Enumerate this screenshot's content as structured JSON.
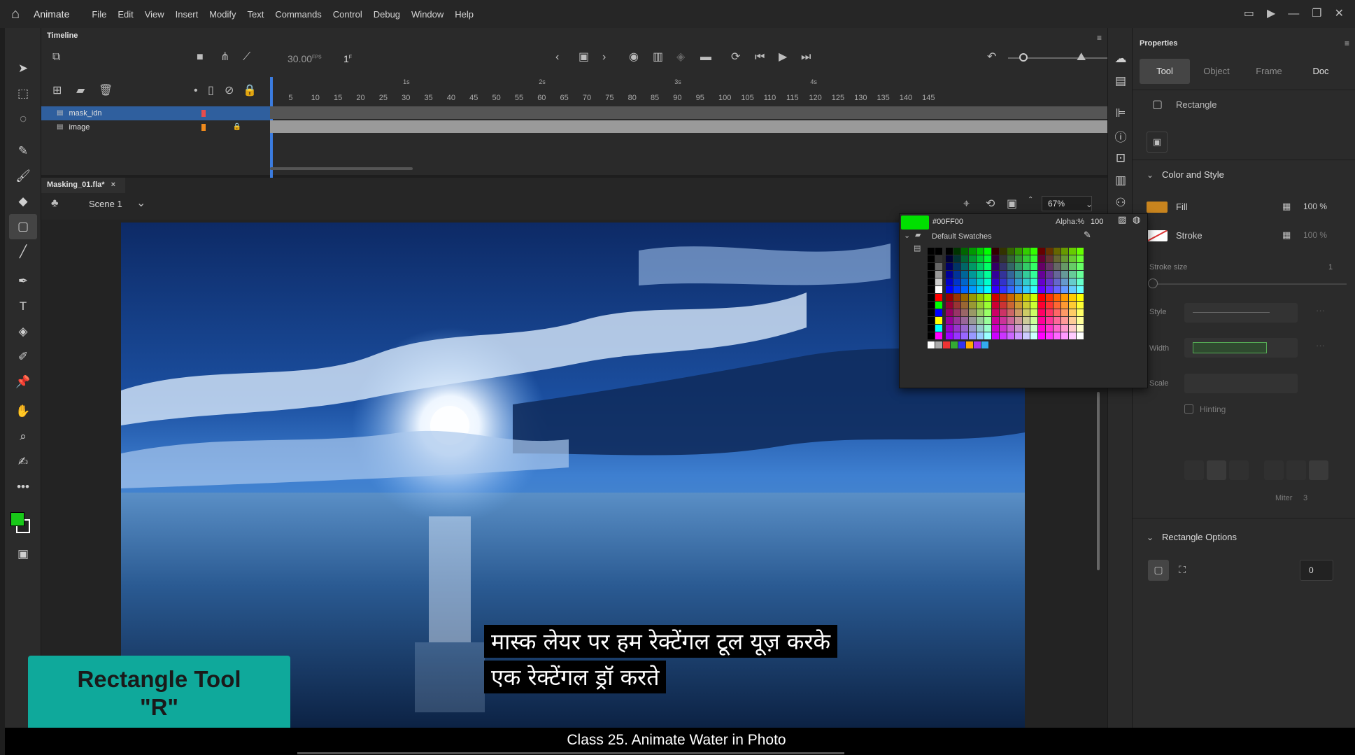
{
  "menubar": {
    "app_name": "Animate",
    "items": [
      "File",
      "Edit",
      "View",
      "Insert",
      "Modify",
      "Text",
      "Commands",
      "Control",
      "Debug",
      "Window",
      "Help"
    ]
  },
  "timeline": {
    "title": "Timeline",
    "fps": "30.00",
    "fps_unit": "FPS",
    "frame": "1",
    "frame_unit": "F",
    "seconds": [
      "1s",
      "2s",
      "3s",
      "4s"
    ],
    "frame_ticks": [
      "5",
      "10",
      "15",
      "20",
      "25",
      "30",
      "35",
      "40",
      "45",
      "50",
      "55",
      "60",
      "65",
      "70",
      "75",
      "80",
      "85",
      "90",
      "95",
      "100",
      "105",
      "110",
      "115",
      "120",
      "125",
      "130",
      "135",
      "140",
      "145"
    ],
    "layers": [
      {
        "name": "mask_idn",
        "color": "#e84c4c",
        "selected": true,
        "locked": false
      },
      {
        "name": "image",
        "color": "#f08a1c",
        "selected": false,
        "locked": true
      }
    ]
  },
  "document": {
    "tab": "Masking_01.fla*",
    "close": "×",
    "scene": "Scene 1",
    "zoom": "67%"
  },
  "swatch_popup": {
    "hex": "#00FF00",
    "alpha_label": "Alpha:%",
    "alpha_value": "100",
    "group": "Default Swatches"
  },
  "properties": {
    "title": "Properties",
    "tabs": [
      "Tool",
      "Object",
      "Frame",
      "Doc"
    ],
    "active_tab": "Tool",
    "tool_name": "Rectangle",
    "color_style_header": "Color and Style",
    "fill_label": "Fill",
    "fill_color": "#c8841e",
    "fill_alpha": "100 %",
    "stroke_label": "Stroke",
    "stroke_alpha": "100 %",
    "stroke_size_label": "Stroke size",
    "stroke_size_value": "1",
    "style_label": "Style",
    "width_label": "Width",
    "scale_label": "Scale",
    "hinting_label": "Hinting",
    "miter_label": "Miter",
    "miter_value": "3",
    "rect_options_header": "Rectangle Options",
    "corner_value": "0"
  },
  "toolbar": {
    "fill_swatch": "#18c818",
    "stroke_swatch": "#ffffff"
  },
  "overlay": {
    "subtitle_line1": "मास्क लेयर पर हम रेक्टेंगल टूल यूज़ करके",
    "subtitle_line2": "एक रेक्टेंगल ड्रॉ करते",
    "badge_line1": "Rectangle Tool",
    "badge_line2": "\"R\"",
    "caption": "Class 25. Animate Water in Photo"
  }
}
